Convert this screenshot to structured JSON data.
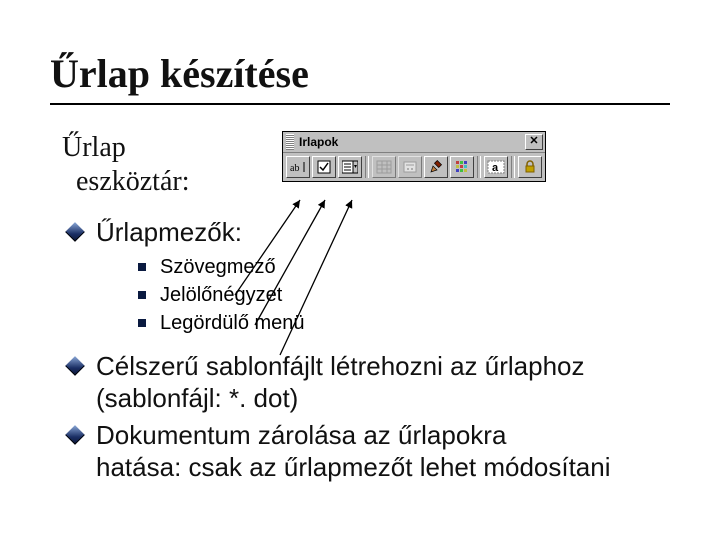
{
  "title": "Űrlap készítése",
  "subtitle_line1": "Űrlap",
  "subtitle_line2": "eszköztár:",
  "toolbar": {
    "title": "Irlapok",
    "buttons": [
      {
        "name": "text-field-icon",
        "label": "ab|"
      },
      {
        "name": "checkbox-icon",
        "label": "checkbox"
      },
      {
        "name": "dropdown-icon",
        "label": "dropdown"
      },
      {
        "name": "table-icon",
        "label": "table"
      },
      {
        "name": "properties-icon",
        "label": "props"
      },
      {
        "name": "draw-icon",
        "label": "draw"
      },
      {
        "name": "grid-icon",
        "label": "grid"
      },
      {
        "name": "shade-toggle-icon",
        "label": "a-shade"
      },
      {
        "name": "lock-icon",
        "label": "lock"
      }
    ]
  },
  "bullets": {
    "fields_heading": "Űrlapmezők:",
    "field_items": [
      "Szövegmező",
      "Jelölőnégyzet",
      "Legördülő menü"
    ],
    "template_lines": [
      "Célszerű sablonfájlt létrehozni az űrlaphoz",
      "(sablonfájl: *. dot)"
    ],
    "lock_lines": [
      "Dokumentum zárolása az űrlapokra",
      "hatása: csak az űrlapmezőt lehet módosítani"
    ]
  }
}
